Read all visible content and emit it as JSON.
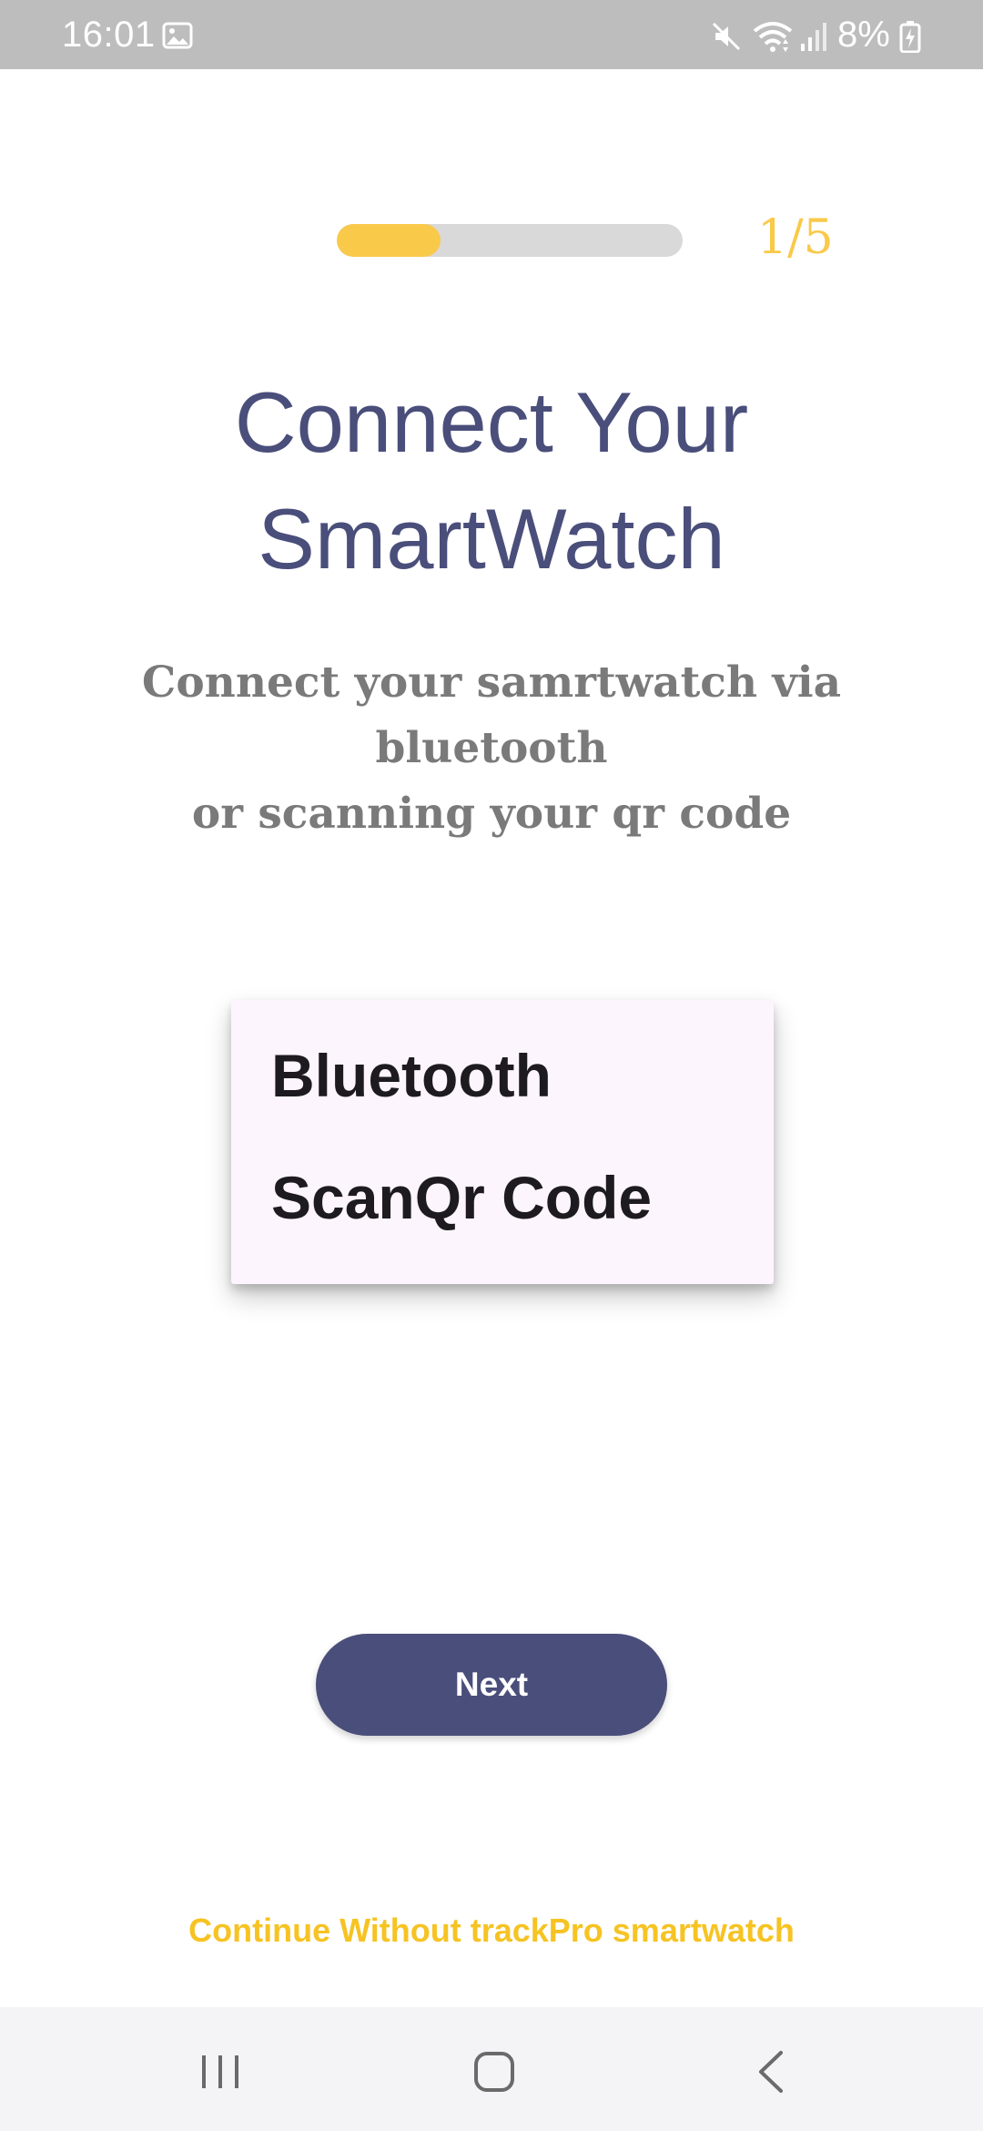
{
  "status_bar": {
    "time": "16:01",
    "battery_percent": "8%",
    "icons": [
      "gallery-icon",
      "mute-icon",
      "wifi-icon",
      "signal-icon",
      "battery-icon"
    ]
  },
  "progress": {
    "counter": "1/5",
    "fraction": 0.3,
    "fill_color": "#f9c94a",
    "track_color": "#d9d9d9"
  },
  "header": {
    "title_line1": "Connect Your",
    "title_line2": "SmartWatch",
    "subtitle_line1": "Connect your samrtwatch via bluetooth",
    "subtitle_line2": "or scanning your qr code"
  },
  "menu": {
    "items": [
      "Bluetooth",
      "ScanQr Code"
    ]
  },
  "actions": {
    "next_label": "Next",
    "continue_label": "Continue Without trackPro smartwatch"
  },
  "nav_bar": {
    "icons": [
      "recents-icon",
      "home-icon",
      "back-icon"
    ]
  },
  "colors": {
    "primary": "#4a4e7a",
    "accent": "#f9c94a",
    "link": "#f6c323",
    "subtitle": "#7a7a7a"
  }
}
